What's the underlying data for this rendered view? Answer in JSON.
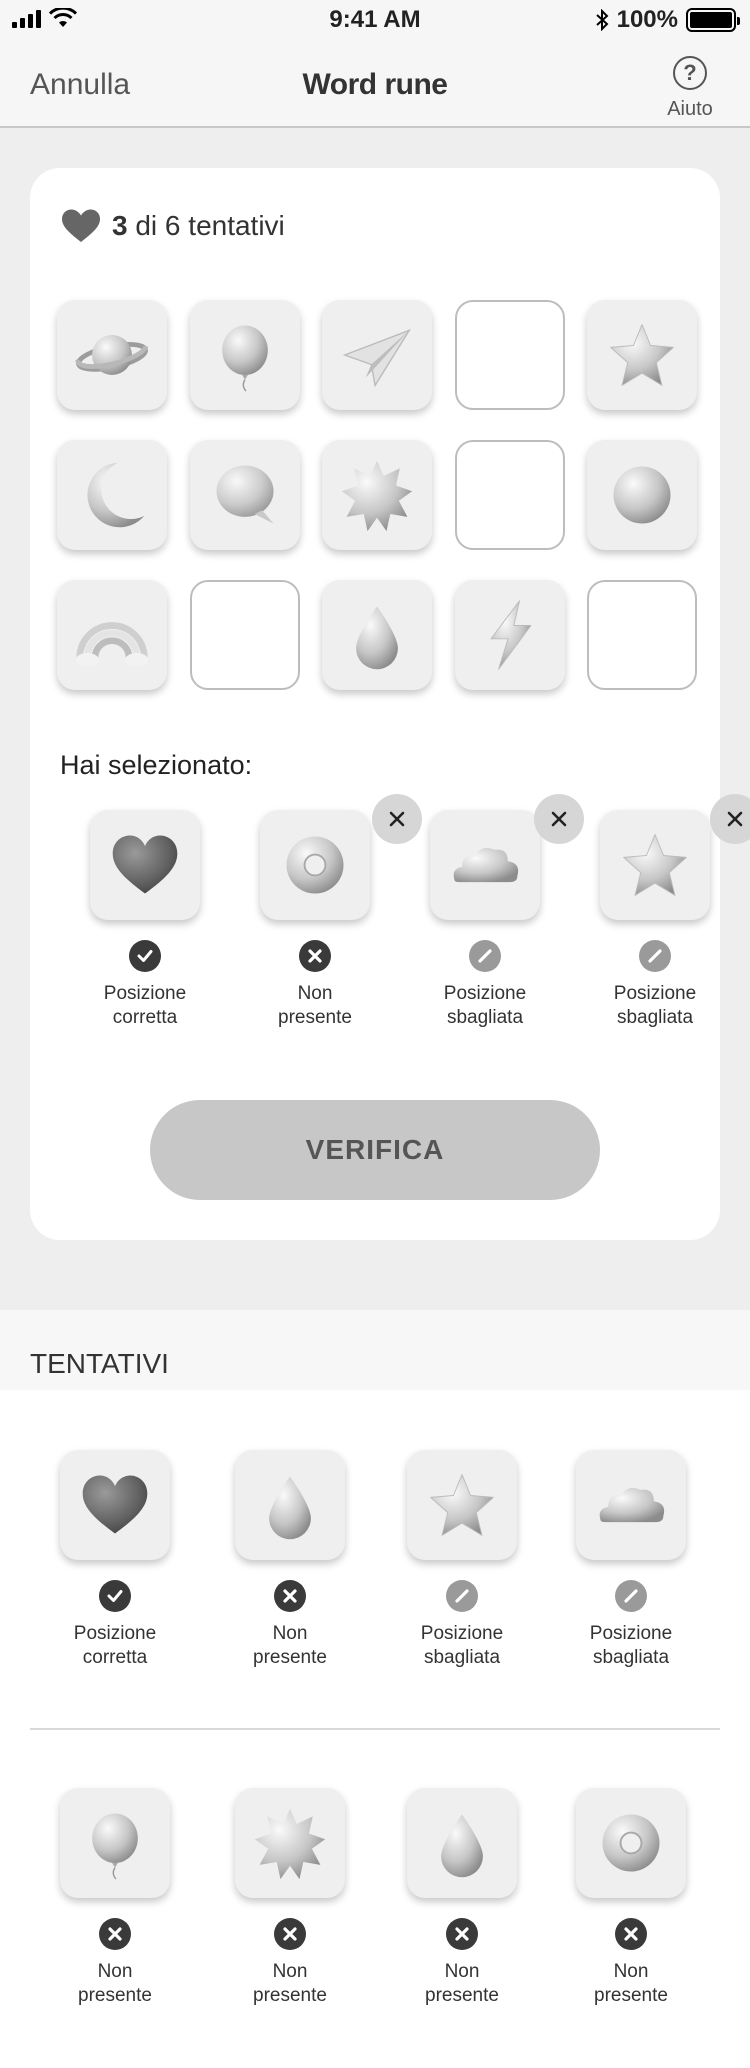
{
  "status_bar": {
    "time": "9:41 AM",
    "battery": "100%"
  },
  "nav": {
    "cancel": "Annulla",
    "title": "Word rune",
    "help_label": "Aiuto",
    "help_symbol": "?"
  },
  "game": {
    "lives_current": "3",
    "lives_text": "di 6 tentativi",
    "grid": [
      [
        "planet",
        "balloon",
        "paper-plane",
        "empty",
        "star"
      ],
      [
        "moon",
        "speech-bubble",
        "sun",
        "empty",
        "sphere"
      ],
      [
        "rainbow",
        "empty",
        "drop",
        "lightning",
        "empty"
      ]
    ],
    "selected_title": "Hai selezionato:",
    "selected": [
      {
        "icon": "heart",
        "status": "correct",
        "label": "Posizione\ncorretta",
        "removable": false
      },
      {
        "icon": "donut",
        "status": "absent",
        "label": "Non\npresente",
        "removable": true
      },
      {
        "icon": "cloud",
        "status": "wrong-position",
        "label": "Posizione\nsbagliata",
        "removable": true
      },
      {
        "icon": "star",
        "status": "wrong-position",
        "label": "Posizione\nsbagliata",
        "removable": true
      }
    ],
    "verify_label": "VERIFICA"
  },
  "attempts": {
    "title": "TENTATIVI",
    "rows": [
      [
        {
          "icon": "heart",
          "status": "correct",
          "label": "Posizione\ncorretta"
        },
        {
          "icon": "drop",
          "status": "absent",
          "label": "Non\npresente"
        },
        {
          "icon": "star",
          "status": "wrong-position",
          "label": "Posizione\nsbagliata"
        },
        {
          "icon": "cloud",
          "status": "wrong-position",
          "label": "Posizione\nsbagliata"
        }
      ],
      [
        {
          "icon": "balloon",
          "status": "absent",
          "label": "Non\npresente"
        },
        {
          "icon": "sun",
          "status": "absent",
          "label": "Non\npresente"
        },
        {
          "icon": "drop",
          "status": "absent",
          "label": "Non\npresente"
        },
        {
          "icon": "donut",
          "status": "absent",
          "label": "Non\npresente"
        }
      ]
    ]
  }
}
